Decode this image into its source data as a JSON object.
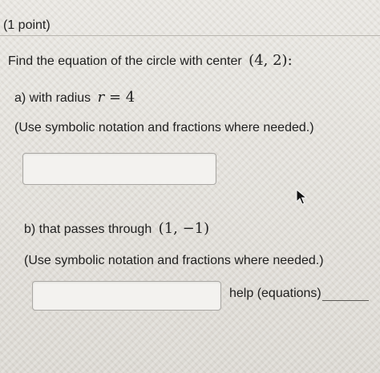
{
  "header": {
    "points": "(1 point)"
  },
  "question": {
    "prompt_text": "Find the equation of the circle with center",
    "center": "(4, 2):"
  },
  "part_a": {
    "label": "a) with radius",
    "radius_expr_var": "r",
    "radius_expr_rest": " = 4",
    "note": "(Use symbolic notation and fractions where needed.)",
    "answer_value": ""
  },
  "part_b": {
    "label": "b) that passes through",
    "point": "(1, −1)",
    "note": "(Use symbolic notation and fractions where needed.)",
    "answer_value": "",
    "help_link": "help (equations)"
  },
  "icons": {
    "cursor": "mouse-pointer-icon"
  }
}
